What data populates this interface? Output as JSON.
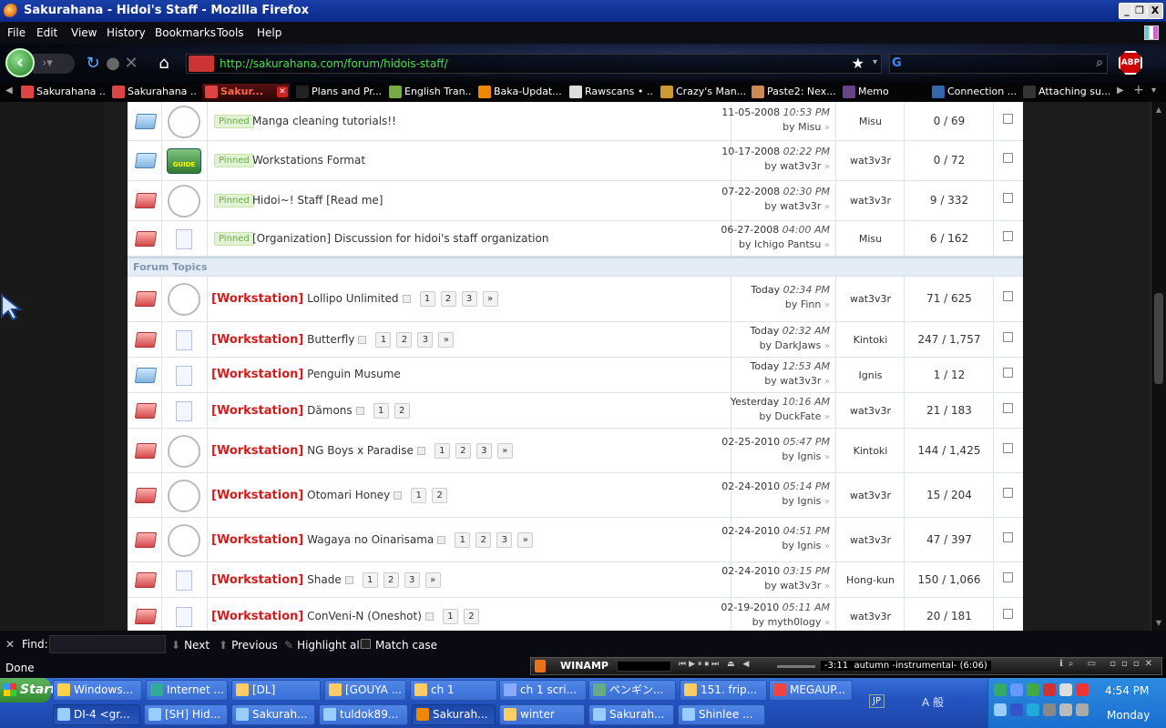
{
  "window": {
    "title": "Sakurahana - Hidoi's Staff - Mozilla Firefox",
    "controls": [
      "_",
      "❐",
      "X"
    ]
  },
  "menu": [
    "File",
    "Edit",
    "View",
    "History",
    "Bookmarks",
    "Tools",
    "Help"
  ],
  "nav": {
    "url": "http://sakurahana.com/forum/hidois-staff/"
  },
  "tabs": [
    {
      "label": "Sakurahana ...",
      "color": "#d44"
    },
    {
      "label": "Sakurahana ...",
      "color": "#d44"
    },
    {
      "label": "Sakur...",
      "color": "#d44",
      "active": true
    },
    {
      "label": "Plans and Pr...",
      "color": "#222"
    },
    {
      "label": "English Tran...",
      "color": "#7a4"
    },
    {
      "label": "Baka-Updat...",
      "color": "#e80"
    },
    {
      "label": "Rawscans • ...",
      "color": "#ddd"
    },
    {
      "label": "Crazy's Man...",
      "color": "#c93"
    },
    {
      "label": "Paste2: Nex...",
      "color": "#c85"
    },
    {
      "label": "Memo",
      "color": "#648"
    },
    {
      "label": "Connection ...",
      "color": "#36a"
    },
    {
      "label": "Attaching su...",
      "color": "#333"
    }
  ],
  "forum": {
    "section_label": "Forum Topics",
    "prefix_label": "[Workstation]",
    "pinned_label": "Pinned",
    "pinned": [
      {
        "title": "Manga cleaning tutorials!!",
        "date": "11-05-2008",
        "time": "10:53 PM",
        "by": "by Misu",
        "starter": "Misu",
        "counts": "0 / 69",
        "folder": "cold",
        "icon": "avatar",
        "av": "#c9d6f0"
      },
      {
        "title": "Workstations Format",
        "date": "10-17-2008",
        "time": "02:22 PM",
        "by": "by wat3v3r",
        "starter": "wat3v3r",
        "counts": "0 / 72",
        "folder": "cold",
        "icon": "guide",
        "guide_text": "GUIDE"
      },
      {
        "title": "Hidoi~! Staff [Read me]",
        "date": "07-22-2008",
        "time": "02:30 PM",
        "by": "by wat3v3r",
        "starter": "wat3v3r",
        "counts": "9 / 332",
        "folder": "hot",
        "icon": "avatar",
        "av": "#f3c0c8"
      },
      {
        "title": "[Organization] Discussion for hidoi's staff organization",
        "date": "06-27-2008",
        "time": "04:00 AM",
        "by": "by Ichigo Pantsu",
        "starter": "Misu",
        "counts": "6 / 162",
        "folder": "hot",
        "icon": "doc"
      }
    ],
    "topics": [
      {
        "title": "Lollipo Unlimited",
        "pages": [
          "1",
          "2",
          "3",
          "»"
        ],
        "date": "Today",
        "time": "02:34 PM",
        "by": "by Finn",
        "starter": "wat3v3r",
        "counts": "71 / 625",
        "folder": "hot",
        "icon": "avatar",
        "av": "#d8e0f5"
      },
      {
        "title": "Butterfly",
        "pages": [
          "1",
          "2",
          "3",
          "»"
        ],
        "date": "Today",
        "time": "02:32 AM",
        "by": "by DarkJaws",
        "starter": "Kintoki",
        "counts": "247 / 1,757",
        "folder": "hot",
        "icon": "doc"
      },
      {
        "title": "Penguin Musume",
        "pages": [],
        "date": "Today",
        "time": "12:53 AM",
        "by": "by wat3v3r",
        "starter": "Ignis",
        "counts": "1 / 12",
        "folder": "cold",
        "icon": "doc"
      },
      {
        "title": "Dämons",
        "pages": [
          "1",
          "2"
        ],
        "date": "Yesterday",
        "time": "10:16 AM",
        "by": "by DuckFate",
        "starter": "wat3v3r",
        "counts": "21 / 183",
        "folder": "hot",
        "icon": "doc"
      },
      {
        "title": "NG Boys x Paradise",
        "pages": [
          "1",
          "2",
          "3",
          "»"
        ],
        "date": "02-25-2010",
        "time": "05:47 PM",
        "by": "by Ignis",
        "starter": "Kintoki",
        "counts": "144 / 1,425",
        "folder": "hot",
        "icon": "avatar",
        "av": "#6c7fd8"
      },
      {
        "title": "Otomari Honey",
        "pages": [
          "1",
          "2"
        ],
        "date": "02-24-2010",
        "time": "05:14 PM",
        "by": "by Ignis",
        "starter": "wat3v3r",
        "counts": "15 / 204",
        "folder": "hot",
        "icon": "avatar",
        "av": "#4a3a4a"
      },
      {
        "title": "Wagaya no Oinarisama",
        "pages": [
          "1",
          "2",
          "3",
          "»"
        ],
        "date": "02-24-2010",
        "time": "04:51 PM",
        "by": "by Ignis",
        "starter": "wat3v3r",
        "counts": "47 / 397",
        "folder": "hot",
        "icon": "avatar",
        "av": "#e0b060"
      },
      {
        "title": "Shade",
        "pages": [
          "1",
          "2",
          "3",
          "»"
        ],
        "date": "02-24-2010",
        "time": "03:15 PM",
        "by": "by wat3v3r",
        "starter": "Hong-kun",
        "counts": "150 / 1,066",
        "folder": "hot",
        "icon": "doc"
      },
      {
        "title": "ConVeni-N (Oneshot)",
        "pages": [
          "1",
          "2"
        ],
        "date": "02-19-2010",
        "time": "05:11 AM",
        "by": "by myth0logy",
        "starter": "wat3v3r",
        "counts": "20 / 181",
        "folder": "hot",
        "icon": "doc"
      }
    ]
  },
  "findbar": {
    "find_label": "Find:",
    "next": "Next",
    "previous": "Previous",
    "highlight": "Highlight all",
    "match_case": "Match case"
  },
  "status": "Done",
  "winamp": {
    "name": "WINAMP",
    "time": "-3:11",
    "track": "autumn -instrumental- (6:06)"
  },
  "taskbar": {
    "start": "Start",
    "row1": [
      {
        "label": "Windows...",
        "color": "#ffd24a"
      },
      {
        "label": "Internet ...",
        "color": "#3a9"
      },
      {
        "label": "[DL]",
        "color": "#fc6"
      },
      {
        "label": "[GOUYA ...",
        "color": "#fc6"
      },
      {
        "label": "ch 1",
        "color": "#fc6"
      },
      {
        "label": "ch 1 scri...",
        "color": "#8af"
      },
      {
        "label": "ペンギン...",
        "color": "#6a8"
      },
      {
        "label": "151. frip...",
        "color": "#fc6"
      },
      {
        "label": "MEGAUP...",
        "color": "#e44"
      }
    ],
    "row2": [
      {
        "label": "DI-4 <gr...",
        "color": "#9cf",
        "active": true
      },
      {
        "label": "[SH] Hid...",
        "color": "#9cf"
      },
      {
        "label": "Sakurah...",
        "color": "#9cf"
      },
      {
        "label": "tuldok89...",
        "color": "#9cf"
      },
      {
        "label": "Sakurah...",
        "color": "#e80",
        "active": true
      },
      {
        "label": "winter",
        "color": "#fc6"
      },
      {
        "label": "Sakurah...",
        "color": "#9cf"
      },
      {
        "label": "Shinlee ...",
        "color": "#9cf"
      }
    ],
    "lang": "JP",
    "ime": "A 般",
    "clock": "4:54 PM",
    "day": "Monday"
  }
}
